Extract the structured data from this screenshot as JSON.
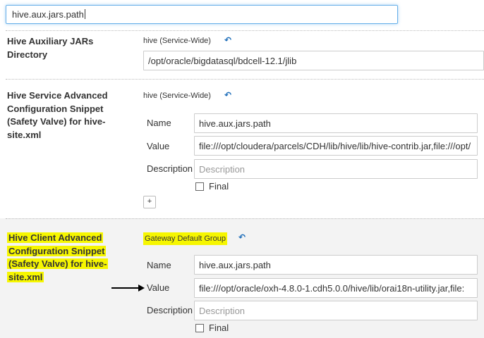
{
  "search": {
    "value": "hive.aux.jars.path"
  },
  "properties": [
    {
      "title": "Hive Auxiliary JARs Directory",
      "scope": "hive (Service-Wide)",
      "value": "/opt/oracle/bigdatasql/bdcell-12.1/jlib"
    },
    {
      "title": "Hive Service Advanced Configuration Snippet (Safety Valve) for hive-site.xml",
      "scope": "hive (Service-Wide)",
      "name_label": "Name",
      "name_value": "hive.aux.jars.path",
      "value_label": "Value",
      "value_value": "file:///opt/cloudera/parcels/CDH/lib/hive/lib/hive-contrib.jar,file:///opt/",
      "description_label": "Description",
      "description_placeholder": "Description",
      "final_label": "Final",
      "add_label": "+"
    },
    {
      "title": "Hive Client Advanced Configuration Snippet (Safety Valve) for hive-site.xml",
      "scope": "Gateway Default Group",
      "name_label": "Name",
      "name_value": "hive.aux.jars.path",
      "value_label": "Value",
      "value_value": "file:///opt/oracle/oxh-4.8.0-1.cdh5.0.0/hive/lib/orai18n-utility.jar,file:",
      "description_label": "Description",
      "description_placeholder": "Description",
      "final_label": "Final"
    }
  ],
  "icons": {
    "revert": "revert-arrow-icon",
    "annotation": "arrow-right-icon"
  },
  "colors": {
    "highlight": "#f6f600",
    "link": "#1a6bb8",
    "focus": "#66afe9"
  }
}
